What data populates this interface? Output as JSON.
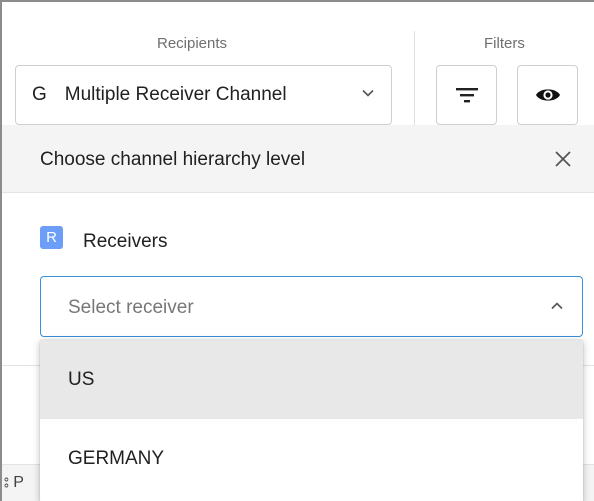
{
  "toolbar": {
    "recipients_label": "Recipients",
    "filters_label": "Filters",
    "recipient_prefix": "G",
    "recipient_value": "Multiple Receiver Channel",
    "chevron_icon": "chevron-down-icon",
    "filter_icon": "filter-icon",
    "eye_icon": "eye-icon"
  },
  "panel": {
    "title": "Choose channel hierarchy level",
    "close_icon": "close-icon",
    "receivers_badge": "R",
    "receivers_label": "Receivers",
    "receiver_placeholder": "Select receiver",
    "options": [
      "US",
      "GERMANY"
    ],
    "highlighted_option": "US"
  },
  "background": {
    "footer_text": "⦂ P"
  },
  "colors": {
    "accent": "#3b8fd6",
    "badge": "#6c9ef8",
    "header_bg": "#f4f4f5",
    "hover_bg": "#e8e8e8"
  }
}
